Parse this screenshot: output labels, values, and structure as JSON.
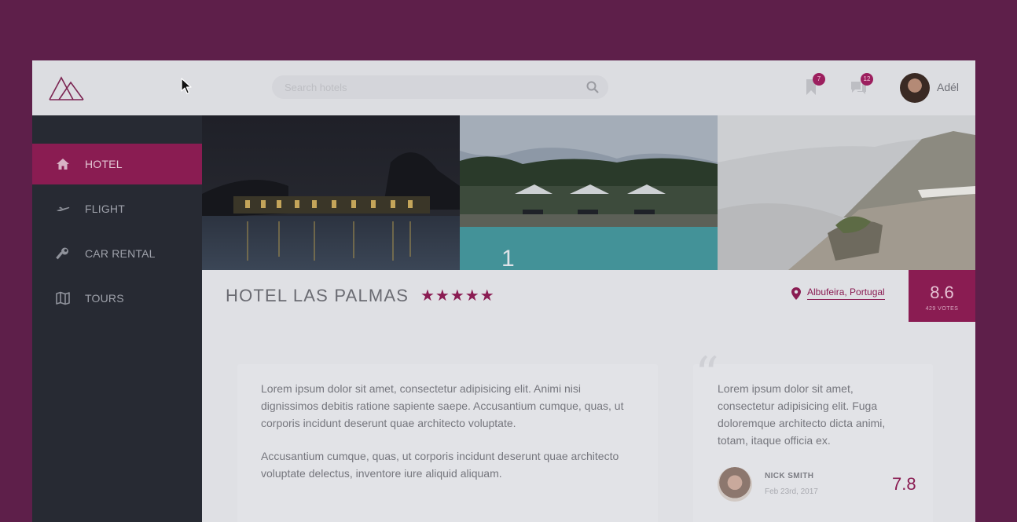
{
  "brand": {
    "accent": "#8a1c52",
    "logo": "mountain-logo-icon"
  },
  "header": {
    "search_placeholder": "Search hotels",
    "bookmarks_badge": "7",
    "messages_badge": "12",
    "user_name": "Adél"
  },
  "sidebar": {
    "items": [
      {
        "label": "HOTEL",
        "icon": "home-icon",
        "active": true
      },
      {
        "label": "FLIGHT",
        "icon": "plane-icon",
        "active": false
      },
      {
        "label": "CAR RENTAL",
        "icon": "wrench-icon",
        "active": false
      },
      {
        "label": "TOURS",
        "icon": "map-icon",
        "active": false
      }
    ]
  },
  "gallery": {
    "current_slide": "1"
  },
  "hotel": {
    "name": "HOTEL LAS PALMAS",
    "stars": "★★★★★",
    "location": "Albufeira, Portugal",
    "score": "8.6",
    "votes": "429 VOTES"
  },
  "description": {
    "p1": "Lorem ipsum dolor sit amet, consectetur adipisicing elit. Animi nisi dignissimos debitis ratione sapiente saepe. Accusantium cumque, quas, ut corporis incidunt deserunt quae architecto voluptate.",
    "p2": "Accusantium cumque, quas, ut corporis incidunt deserunt quae architecto voluptate delectus, inventore iure aliquid aliquam."
  },
  "review": {
    "text": "Lorem ipsum dolor sit amet, consectetur adipisicing elit. Fuga doloremque architecto dicta animi, totam, itaque officia ex.",
    "author": "NICK SMITH",
    "date": "Feb 23rd, 2017",
    "score": "7.8"
  }
}
